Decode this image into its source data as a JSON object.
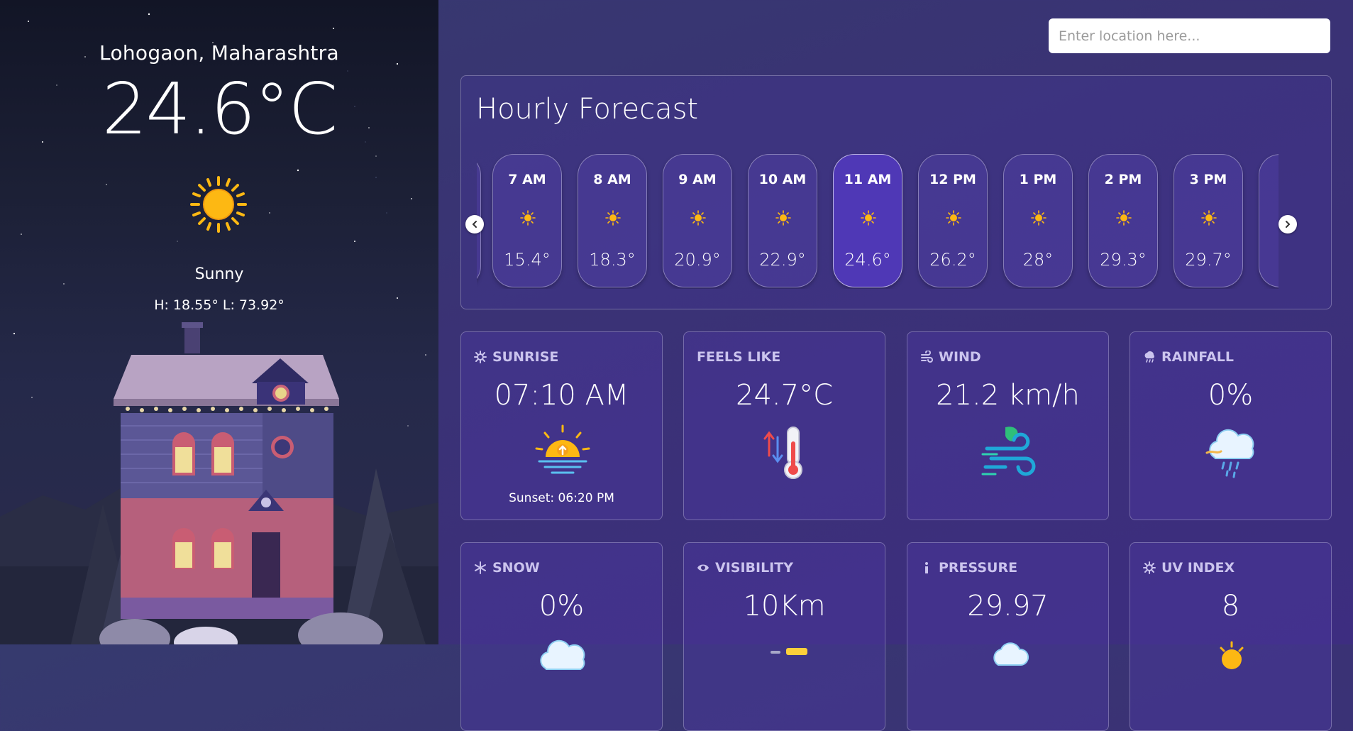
{
  "current": {
    "location": "Lohogaon, Maharashtra",
    "temperature": "24.6°C",
    "condition": "Sunny",
    "high_low": "H: 18.55° L: 73.92°",
    "icon": "sun-icon"
  },
  "search": {
    "placeholder": "Enter location here..."
  },
  "hourly": {
    "title": "Hourly Forecast",
    "items": [
      {
        "time": "7 AM",
        "temp": "15.4°",
        "icon": "sun-icon"
      },
      {
        "time": "8 AM",
        "temp": "18.3°",
        "icon": "sun-icon"
      },
      {
        "time": "9 AM",
        "temp": "20.9°",
        "icon": "sun-icon"
      },
      {
        "time": "10 AM",
        "temp": "22.9°",
        "icon": "sun-icon"
      },
      {
        "time": "11 AM",
        "temp": "24.6°",
        "icon": "sun-icon",
        "active": true
      },
      {
        "time": "12 PM",
        "temp": "26.2°",
        "icon": "sun-icon"
      },
      {
        "time": "1 PM",
        "temp": "28°",
        "icon": "sun-icon"
      },
      {
        "time": "2 PM",
        "temp": "29.3°",
        "icon": "sun-icon"
      },
      {
        "time": "3 PM",
        "temp": "29.7°",
        "icon": "sun-icon"
      }
    ]
  },
  "cards": {
    "sunrise": {
      "label": "SUNRISE",
      "value": "07:10 AM",
      "sub": "Sunset: 06:20 PM",
      "icon": "sunrise-icon"
    },
    "feels_like": {
      "label": "FEELS LIKE",
      "value": "24.7°C",
      "icon": "thermometer-icon"
    },
    "wind": {
      "label": "WIND",
      "value": "21.2 km/h",
      "icon": "wind-icon"
    },
    "rainfall": {
      "label": "RAINFALL",
      "value": "0%",
      "icon": "rain-cloud-icon"
    },
    "snow": {
      "label": "SNOW",
      "value": "0%",
      "icon": "snowflake-icon"
    },
    "visibility": {
      "label": "VISIBILITY",
      "value": "10Km",
      "icon": "eye-icon"
    },
    "pressure": {
      "label": "PRESSURE",
      "value": "29.97",
      "icon": "info-icon"
    },
    "uv_index": {
      "label": "UV INDEX",
      "value": "8",
      "icon": "uv-icon"
    }
  },
  "colors": {
    "accent": "#4f38b6",
    "background": "#3a3275",
    "sun": "#fdb813"
  }
}
